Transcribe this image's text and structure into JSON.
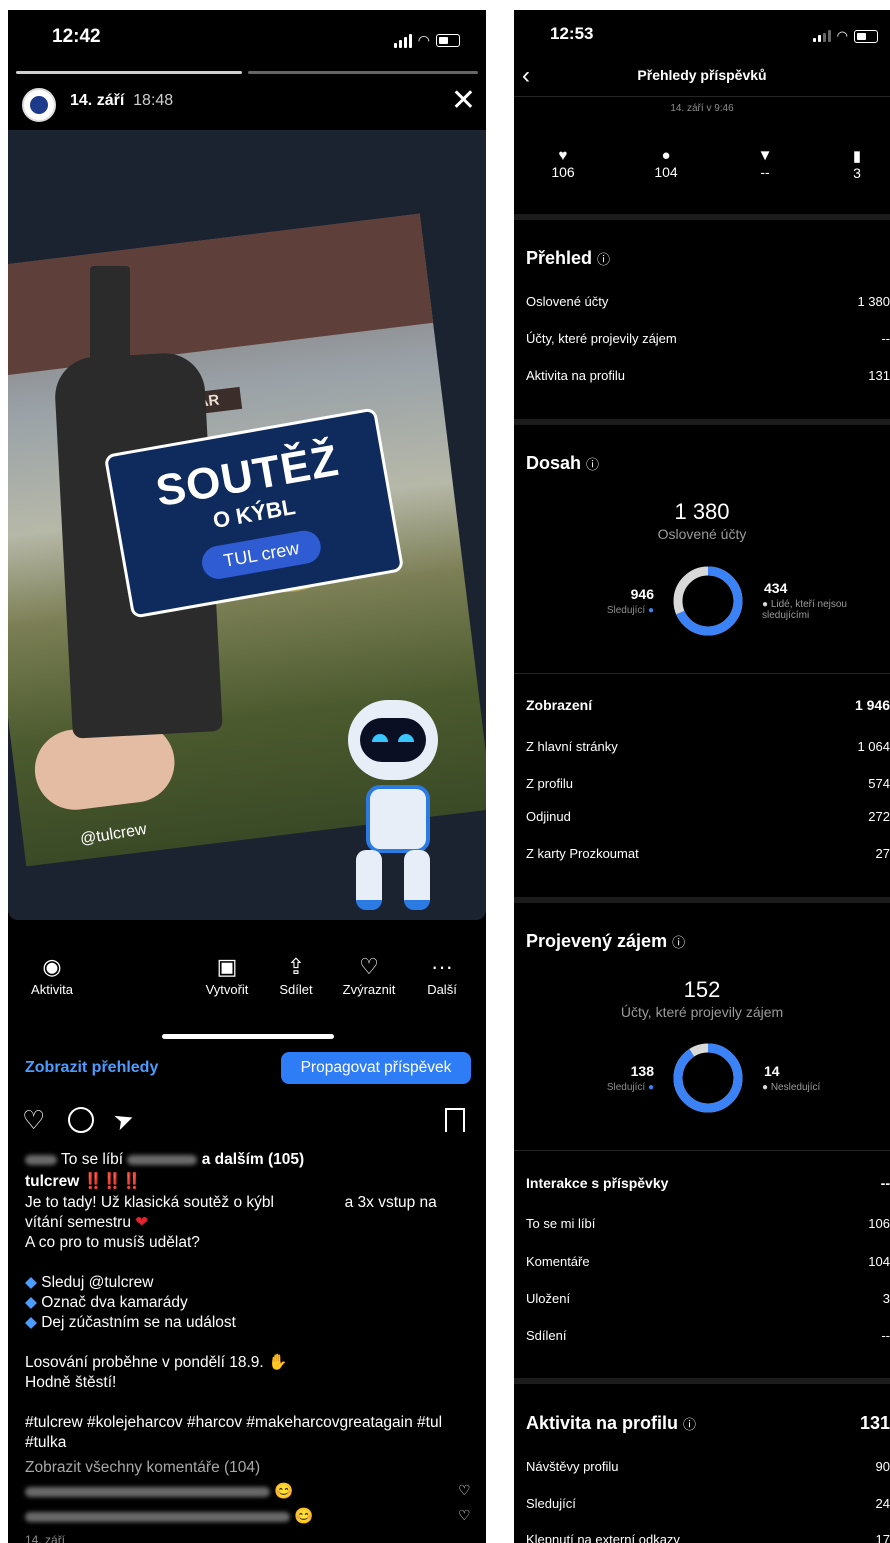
{
  "left": {
    "status_time": "12:42",
    "story_date": "14. září",
    "story_time": "18:48",
    "image_text": {
      "title": "SOUTĚŽ",
      "subtitle": "O KÝBL",
      "badge": "TUL crew",
      "sign": "ZANZIBAR",
      "handle": "@tulcrew"
    },
    "actions": [
      {
        "label": "Aktivita",
        "icon": "eye-icon"
      },
      {
        "label": "Vytvořit",
        "icon": "reels-icon"
      },
      {
        "label": "Sdílet",
        "icon": "share-icon"
      },
      {
        "label": "Zvýraznit",
        "icon": "highlight-icon"
      },
      {
        "label": "Další",
        "icon": "more-icon"
      }
    ],
    "insights_link": "Zobrazit přehledy",
    "promote_button": "Propagovat příspěvek",
    "likes_prefix": "To se líbí",
    "likes_suffix": "a dalším (105)",
    "username": "tulcrew",
    "exclaim": "‼️‼️‼️",
    "caption_line1a": "Je to tady! Už klasická soutěž o kýbl",
    "caption_line1b": "a 3x vstup na",
    "caption_line2": "vítání semestru",
    "caption_line3": "A co pro to musíš udělat?",
    "bullets": [
      "Sleduj @tulcrew",
      "Označ dva kamarády",
      "Dej zúčastním se na událost"
    ],
    "draw_line": "Losování proběhne v pondělí 18.9.",
    "luck_line": "Hodně štěstí!",
    "hashtags_line1": "#tulcrew #kolejeharcov #harcov #makeharcovgreatagain #tul",
    "hashtags_line2": "#tulka",
    "view_comments": "Zobrazit všechny komentáře (104)",
    "post_date": "14. září"
  },
  "right": {
    "status_time": "12:53",
    "header_title": "Přehledy příspěvků",
    "post_time": "14. září v 9:46",
    "stats": [
      {
        "icon": "heart-icon",
        "value": "106"
      },
      {
        "icon": "comment-icon",
        "value": "104"
      },
      {
        "icon": "send-icon",
        "value": "--"
      },
      {
        "icon": "bookmark-icon",
        "value": "3"
      }
    ],
    "overview": {
      "title": "Přehled",
      "rows": [
        {
          "label": "Oslovené účty",
          "value": "1 380"
        },
        {
          "label": "Účty, které projevily zájem",
          "value": "--"
        },
        {
          "label": "Aktivita na profilu",
          "value": "131"
        }
      ]
    },
    "reach": {
      "title": "Dosah",
      "total": "1 380",
      "total_label": "Oslovené účty",
      "followers": "946",
      "followers_label": "Sledující",
      "nonfollowers": "434",
      "nonfollowers_label": "Lidé, kteří nejsou sledujícími",
      "follower_share": 0.686
    },
    "impressions": {
      "title": "Zobrazení",
      "value": "1 946",
      "rows": [
        {
          "label": "Z hlavní stránky",
          "value": "1 064"
        },
        {
          "label": "Z profilu",
          "value": "574"
        },
        {
          "label": "Odjinud",
          "value": "272"
        },
        {
          "label": "Z karty Prozkoumat",
          "value": "27"
        }
      ]
    },
    "engagement": {
      "title": "Projevený zájem",
      "total": "152",
      "total_label": "Účty, které projevily zájem",
      "followers": "138",
      "followers_label": "Sledující",
      "nonfollowers": "14",
      "nonfollowers_label": "Nesledující",
      "follower_share": 0.908
    },
    "interactions": {
      "title": "Interakce s příspěvky",
      "value": "--",
      "rows": [
        {
          "label": "To se mi líbí",
          "value": "106"
        },
        {
          "label": "Komentáře",
          "value": "104"
        },
        {
          "label": "Uložení",
          "value": "3"
        },
        {
          "label": "Sdílení",
          "value": "--"
        }
      ]
    },
    "profile_activity": {
      "title": "Aktivita na profilu",
      "value": "131",
      "rows": [
        {
          "label": "Návštěvy profilu",
          "value": "90"
        },
        {
          "label": "Sledující",
          "value": "24"
        },
        {
          "label": "Klepnutí na externí odkazy",
          "value": "17"
        }
      ]
    },
    "colors": {
      "accent": "#3b82f6",
      "ring_bg": "#d9d9d9"
    }
  }
}
